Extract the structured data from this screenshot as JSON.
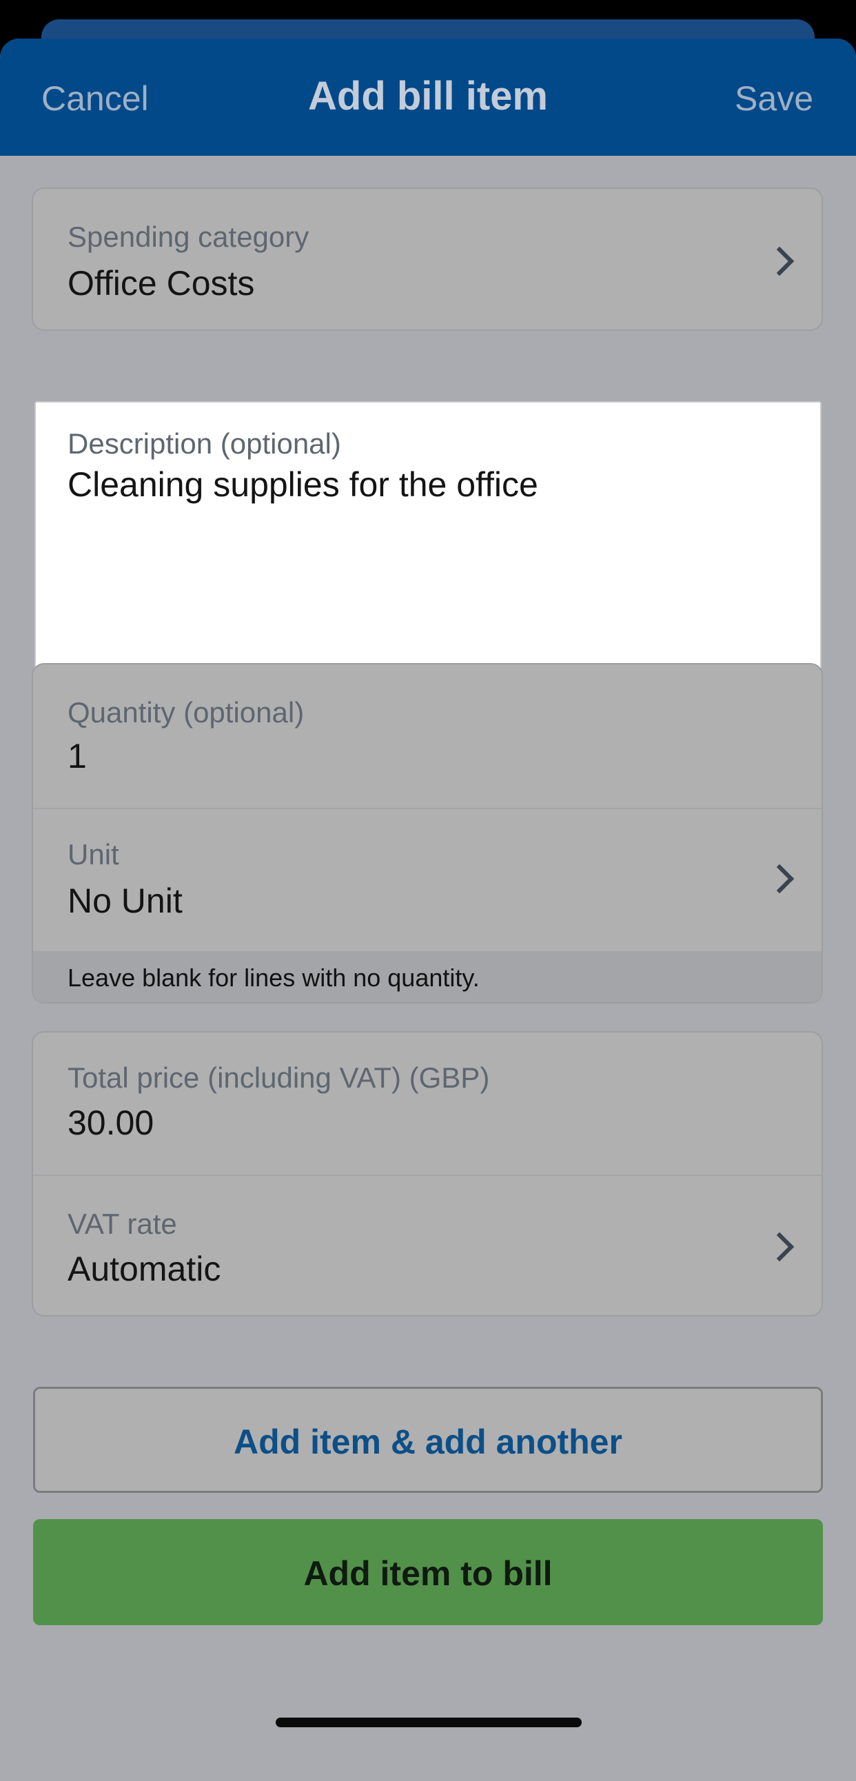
{
  "nav": {
    "cancel_label": "Cancel",
    "title": "Add bill item",
    "save_label": "Save"
  },
  "spending_category": {
    "label": "Spending category",
    "value": "Office Costs"
  },
  "description": {
    "label": "Description (optional)",
    "value": "Cleaning supplies for the office"
  },
  "quantity": {
    "label": "Quantity (optional)",
    "value": "1"
  },
  "unit": {
    "label": "Unit",
    "value": "No Unit",
    "hint": "Leave blank for lines with no quantity."
  },
  "total_price": {
    "label": "Total price (including VAT) (GBP)",
    "value": "30.00"
  },
  "vat_rate": {
    "label": "VAT rate",
    "value": "Automatic"
  },
  "actions": {
    "add_another_label": "Add item & add another",
    "add_to_bill_label": "Add item to bill"
  },
  "colors": {
    "nav_background": "#02498a",
    "primary_button": "#52914a",
    "link_text": "#0c4f88"
  },
  "icons": {
    "row_disclosure": "chevron-right-icon"
  }
}
